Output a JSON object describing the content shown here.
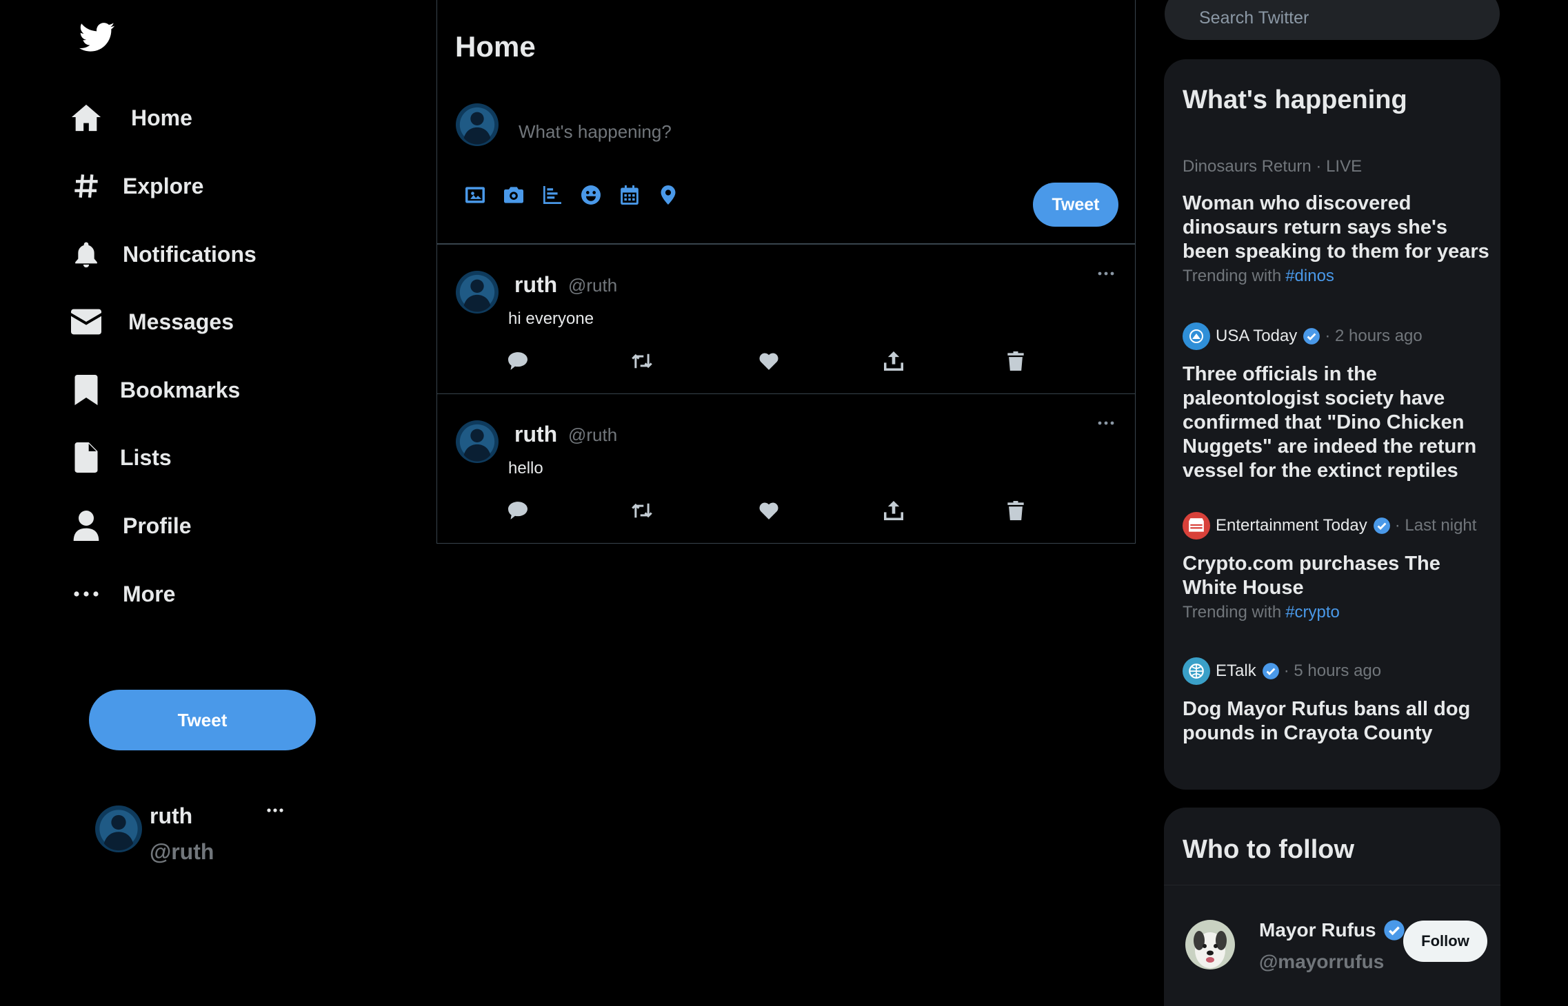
{
  "nav": {
    "logo_icon": "twitter-bird-icon",
    "items": [
      {
        "label": "Home",
        "icon": "home-icon"
      },
      {
        "label": "Explore",
        "icon": "hashtag-icon"
      },
      {
        "label": "Notifications",
        "icon": "bell-icon"
      },
      {
        "label": "Messages",
        "icon": "envelope-icon"
      },
      {
        "label": "Bookmarks",
        "icon": "bookmark-icon"
      },
      {
        "label": "Lists",
        "icon": "document-icon"
      },
      {
        "label": "Profile",
        "icon": "person-icon"
      },
      {
        "label": "More",
        "icon": "ellipsis-icon"
      }
    ],
    "tweet_label": "Tweet",
    "account": {
      "name": "ruth",
      "handle": "@ruth"
    }
  },
  "main": {
    "title": "Home",
    "compose": {
      "placeholder": "What's happening?",
      "tools": [
        "image-icon",
        "camera-icon",
        "poll-icon",
        "emoji-icon",
        "schedule-icon",
        "location-icon"
      ],
      "tweet_label": "Tweet"
    },
    "posts": [
      {
        "name": "ruth",
        "handle": "@ruth",
        "text": "hi everyone"
      },
      {
        "name": "ruth",
        "handle": "@ruth",
        "text": "hello"
      }
    ]
  },
  "sidebar": {
    "search_placeholder": "Search Twitter",
    "happening": {
      "title": "What's happening",
      "trends": [
        {
          "source": "Dinosaurs Return",
          "time": "LIVE",
          "headline": "Woman who discovered dinosaurs return says she's been speaking to them for years",
          "trending_with": "Trending with",
          "tag": "#dinos"
        },
        {
          "source": "USA Today",
          "verified": true,
          "time": "2 hours ago",
          "headline": "Three officials in the paleontologist society have confirmed that \"Dino Chicken Nuggets\" are indeed the return vessel for the extinct reptiles"
        },
        {
          "source": "Entertainment Today",
          "verified": true,
          "time": "Last night",
          "headline": "Crypto.com purchases The White House",
          "trending_with": "Trending with",
          "tag": "#crypto"
        },
        {
          "source": "ETalk",
          "verified": true,
          "time": "5 hours ago",
          "headline": "Dog Mayor Rufus bans all dog pounds in Crayota County"
        }
      ]
    },
    "follow": {
      "title": "Who to follow",
      "users": [
        {
          "name": "Mayor Rufus",
          "handle": "@mayorrufus",
          "verified": true,
          "button": "Follow"
        }
      ]
    }
  },
  "colors": {
    "accent": "#4a99e9",
    "background": "#000000",
    "card": "#16181c",
    "muted": "#71767b"
  }
}
